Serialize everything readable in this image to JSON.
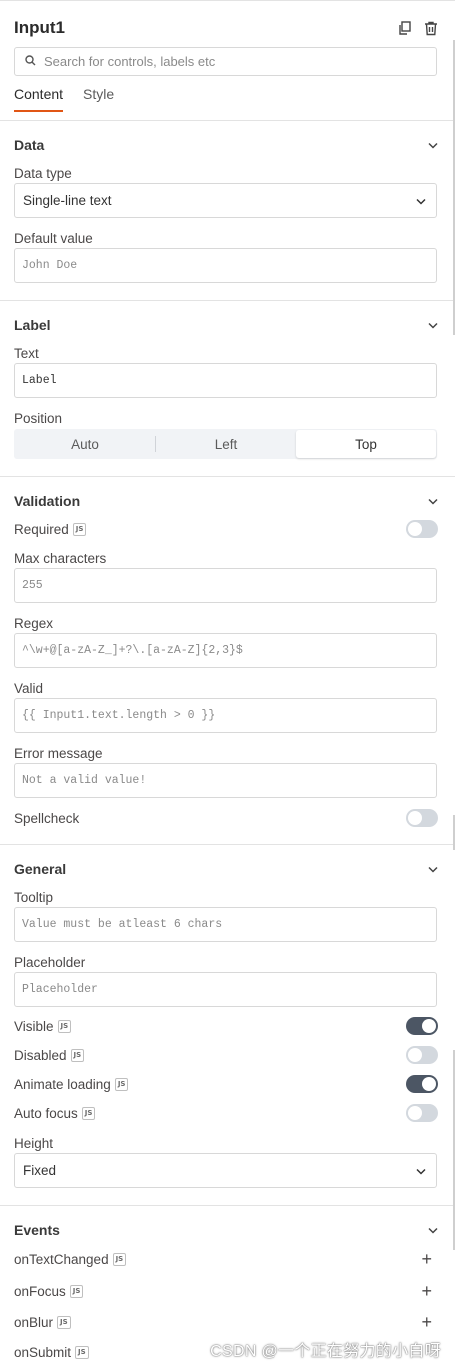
{
  "header": {
    "title": "Input1",
    "copy_icon": "copy-icon",
    "delete_icon": "trash-icon"
  },
  "search": {
    "placeholder": "Search for controls, labels etc",
    "value": ""
  },
  "tabs": [
    {
      "label": "Content",
      "active": true
    },
    {
      "label": "Style",
      "active": false
    }
  ],
  "data": {
    "title": "Data",
    "data_type_label": "Data type",
    "data_type_value": "Single-line text",
    "default_value_label": "Default value",
    "default_value": "John Doe"
  },
  "label_section": {
    "title": "Label",
    "text_label": "Text",
    "text_value": "Label",
    "position_label": "Position",
    "positions": [
      "Auto",
      "Left",
      "Top"
    ],
    "selected_position": "Top"
  },
  "validation": {
    "title": "Validation",
    "required_label": "Required",
    "required_on": false,
    "max_chars_label": "Max characters",
    "max_chars_value": "255",
    "regex_label": "Regex",
    "regex_value": "^\\w+@[a-zA-Z_]+?\\.[a-zA-Z]{2,3}$",
    "valid_label": "Valid",
    "valid_value": "{{ Input1.text.length > 0 }}",
    "error_label": "Error message",
    "error_value": "Not a valid value!",
    "spellcheck_label": "Spellcheck",
    "spellcheck_on": false
  },
  "general": {
    "title": "General",
    "tooltip_label": "Tooltip",
    "tooltip_value": "Value must be atleast 6 chars",
    "placeholder_label": "Placeholder",
    "placeholder_value": "Placeholder",
    "visible_label": "Visible",
    "visible_on": true,
    "disabled_label": "Disabled",
    "disabled_on": false,
    "animate_label": "Animate loading",
    "animate_on": true,
    "autofocus_label": "Auto focus",
    "autofocus_on": false,
    "height_label": "Height",
    "height_value": "Fixed"
  },
  "events": {
    "title": "Events",
    "items": [
      "onTextChanged",
      "onFocus",
      "onBlur",
      "onSubmit"
    ]
  },
  "js_badge": "JS",
  "watermark": "CSDN @一个正在努力的小白呀",
  "colors": {
    "accent": "#e15615",
    "toggle_on": "#4c5664",
    "toggle_off": "#d3d8de"
  }
}
